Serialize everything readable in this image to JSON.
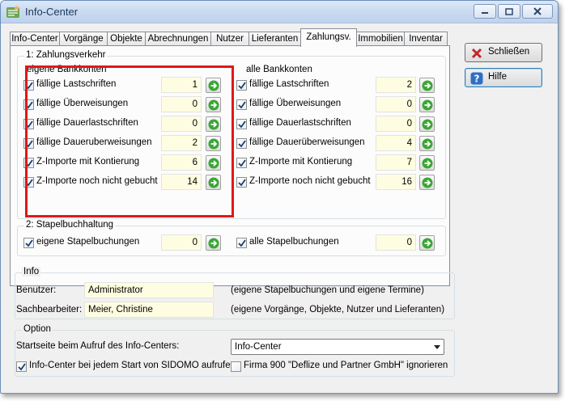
{
  "window": {
    "title": "Info-Center",
    "icon": "sidomo-app-icon"
  },
  "tabs": [
    {
      "label": "Info-Center"
    },
    {
      "label": "Vorgänge"
    },
    {
      "label": "Objekte"
    },
    {
      "label": "Abrechnungen"
    },
    {
      "label": "Nutzer"
    },
    {
      "label": "Lieferanten"
    },
    {
      "label": "Zahlungsv.",
      "active": true
    },
    {
      "label": "Immobilien"
    },
    {
      "label": "Inventar"
    }
  ],
  "zahlungsverkehr": {
    "group_label": "1: Zahlungsverkehr",
    "eigene_header": "eigene Bankkonten",
    "alle_header": "alle Bankkonten",
    "eigene": [
      {
        "label": "fällige Lastschriften",
        "count": "1",
        "checked": true
      },
      {
        "label": "fällige Überweisungen",
        "count": "0",
        "checked": true
      },
      {
        "label": "fällige Dauerlastschriften",
        "count": "0",
        "checked": true
      },
      {
        "label": "fällige Daueruberweisungen",
        "count": "2",
        "checked": true
      },
      {
        "label": "Z-Importe mit Kontierung",
        "count": "6",
        "checked": true
      },
      {
        "label": "Z-Importe noch nicht gebucht",
        "count": "14",
        "checked": true
      }
    ],
    "alle": [
      {
        "label": "fällige Lastschriften",
        "count": "2",
        "checked": true
      },
      {
        "label": "fällige Überweisungen",
        "count": "0",
        "checked": true
      },
      {
        "label": "fällige Dauerlastschriften",
        "count": "0",
        "checked": true
      },
      {
        "label": "fällige Dauerüberweisungen",
        "count": "4",
        "checked": true
      },
      {
        "label": "Z-Importe mit Kontierung",
        "count": "7",
        "checked": true
      },
      {
        "label": "Z-Importe noch nicht gebucht",
        "count": "16",
        "checked": true
      }
    ]
  },
  "stapelbuchhaltung": {
    "group_label": "2: Stapelbuchhaltung",
    "eigene": {
      "label": "eigene Stapelbuchungen",
      "count": "0",
      "checked": true
    },
    "alle": {
      "label": "alle Stapelbuchungen",
      "count": "0",
      "checked": true
    }
  },
  "buttons": {
    "close_label": "Schließen",
    "help_label": "Hilfe"
  },
  "info": {
    "group_label": "Info",
    "benutzer_label": "Benutzer:",
    "benutzer_value": "Administrator",
    "benutzer_hint": "(eigene Stapelbuchungen und eigene Termine)",
    "sachbearbeiter_label": "Sachbearbeiter:",
    "sachbearbeiter_value": "Meier, Christine",
    "sachbearbeiter_hint": "(eigene Vorgänge, Objekte, Nutzer und Lieferanten)"
  },
  "option": {
    "group_label": "Option",
    "startseite_label": "Startseite beim Aufruf des Info-Centers:",
    "startseite_value": "Info-Center",
    "autostart_label": "Info-Center bei jedem Start von SIDOMO aufrufen",
    "autostart_checked": true,
    "firma_label": "Firma 900 \"Deflize und Partner GmbH\" ignorieren",
    "firma_checked": false
  },
  "colors": {
    "highlight": "#e01818",
    "count_field_bg": "#fffde1",
    "go_arrow": "#3aa635"
  }
}
